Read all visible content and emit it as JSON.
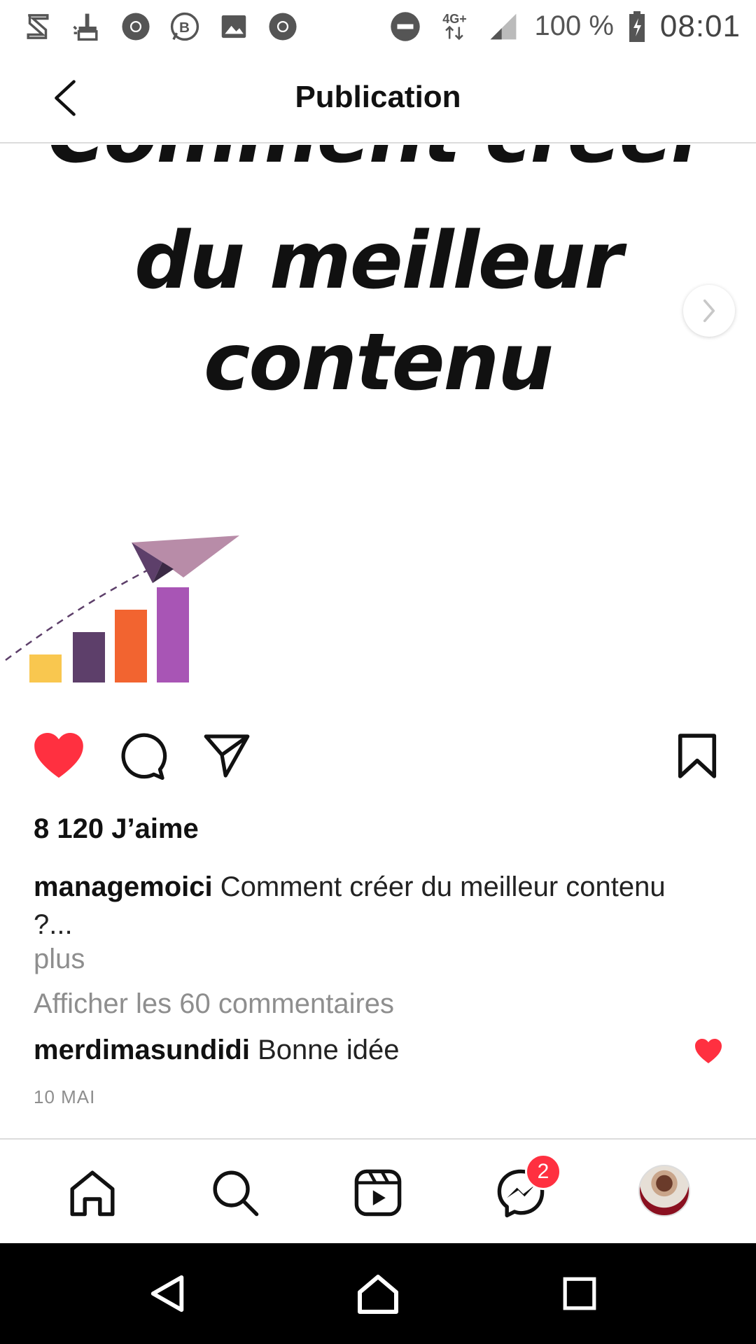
{
  "status_bar": {
    "battery_text": "100 %",
    "time": "08:01",
    "network": "4G+",
    "left_icons": [
      "swiftkey-icon",
      "cleaner-icon",
      "chrome-icon",
      "whatsapp-business-icon",
      "gallery-icon",
      "chrome-icon"
    ],
    "right_icons": [
      "do-not-disturb-icon",
      "data-arrows-icon",
      "signal-icon",
      "battery-charging-icon"
    ]
  },
  "header": {
    "title": "Publication"
  },
  "post": {
    "headline_lines": [
      "Comment créer",
      "du meilleur",
      "contenu"
    ],
    "illustration_bar_colors": [
      "#f9c74f",
      "#5d3f6a",
      "#f26430",
      "#a855b5"
    ],
    "plane_color": "#b88ca8"
  },
  "actions": {
    "liked": true,
    "like_color": "#ff3040"
  },
  "likes_text": "8 120 J’aime",
  "caption": {
    "username": "managemoici",
    "text": "Comment créer du meilleur contenu ?...",
    "more_label": "plus"
  },
  "view_comments_label": "Afficher les 60 commentaires",
  "comment": {
    "username": "merdimasundidi",
    "text": "Bonne idée"
  },
  "date": "10 MAI",
  "bottom_nav": {
    "messenger_badge": "2"
  }
}
